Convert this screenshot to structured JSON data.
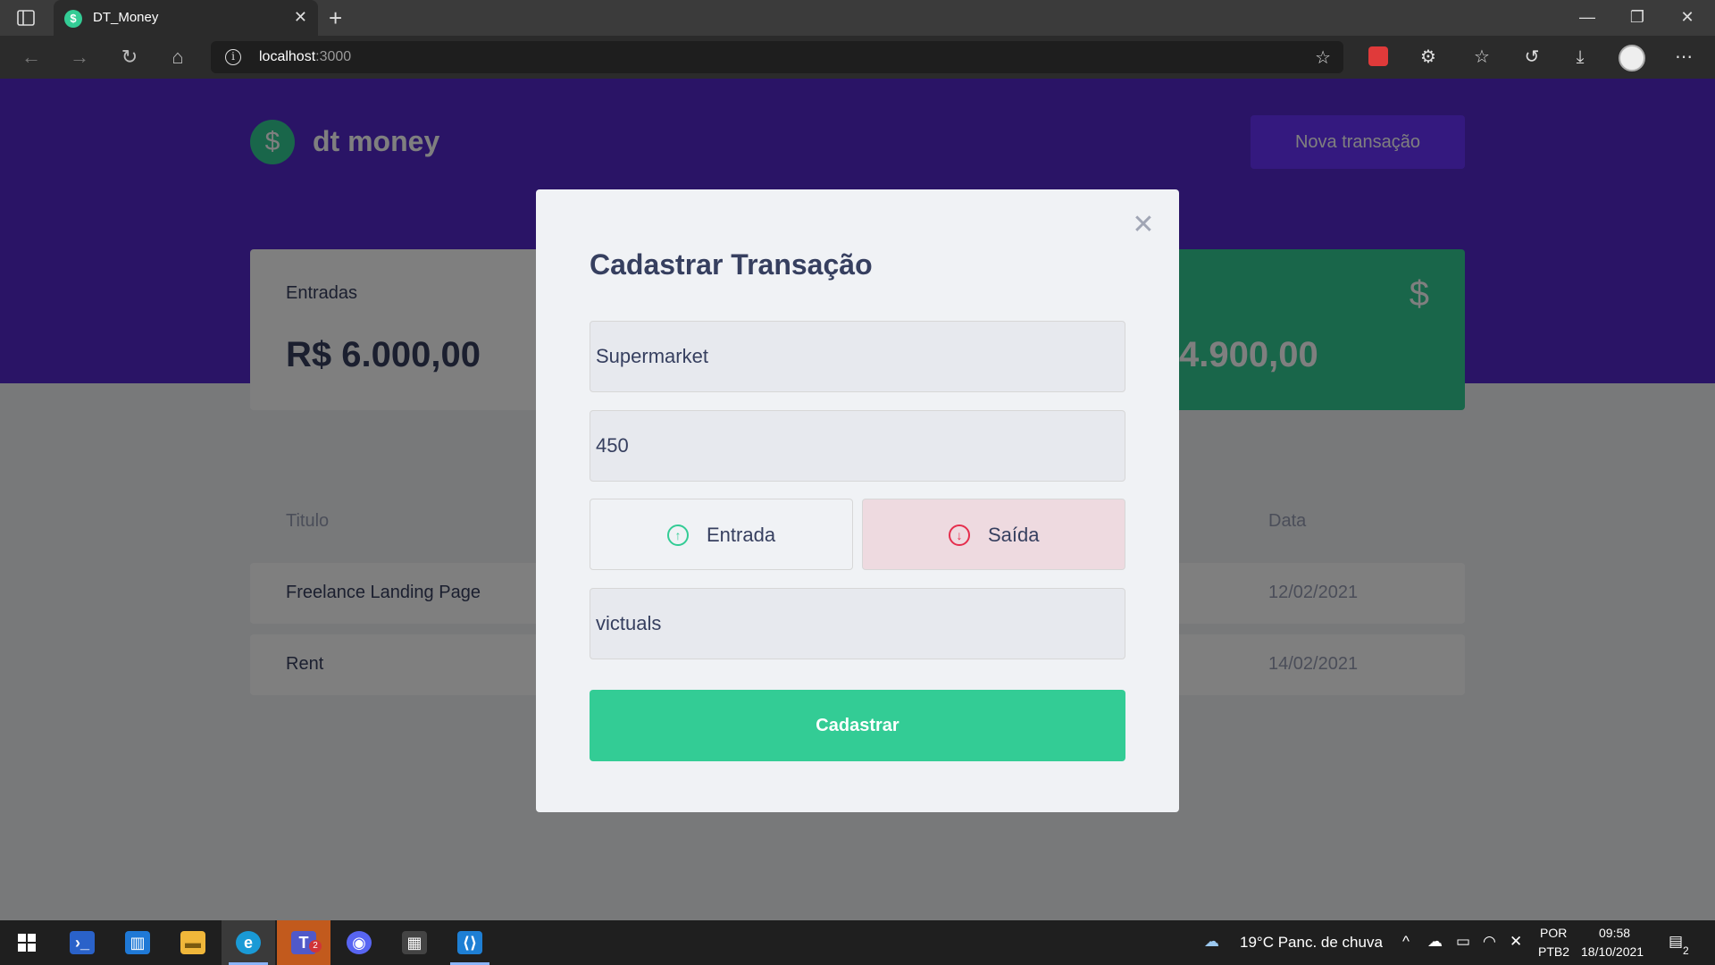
{
  "browser": {
    "tab_title": "DT_Money",
    "favicon": "$",
    "address_host": "localhost",
    "address_port": ":3000"
  },
  "header": {
    "logo_symbol": "$",
    "logo_text": "dt money",
    "new_transaction_label": "Nova transação"
  },
  "summary": {
    "income_label": "Entradas",
    "income_value": "R$ 6.000,00",
    "total_value": "4.900,00",
    "total_icon": "$"
  },
  "table": {
    "columns": {
      "title": "Titulo",
      "date": "Data"
    },
    "rows": [
      {
        "title": "Freelance Landing Page",
        "date": "12/02/2021"
      },
      {
        "title": "Rent",
        "date": "14/02/2021"
      }
    ]
  },
  "modal": {
    "title": "Cadastrar Transação",
    "title_value": "Supermarket",
    "amount_value": "450",
    "deposit_label": "Entrada",
    "withdraw_label": "Saída",
    "category_value": "victuals",
    "submit_label": "Cadastrar",
    "selected_type": "Saída"
  },
  "taskbar": {
    "weather": "19°C  Panc. de chuva",
    "lang_top": "POR",
    "lang_bottom": "PTB2",
    "time": "09:58",
    "date": "18/10/2021",
    "notifications": "2",
    "teams_badge": "2"
  },
  "colors": {
    "header": "#5429cc",
    "accent_green": "#33cc95",
    "accent_red": "#e52e4d",
    "button_purple": "#6933ff"
  }
}
